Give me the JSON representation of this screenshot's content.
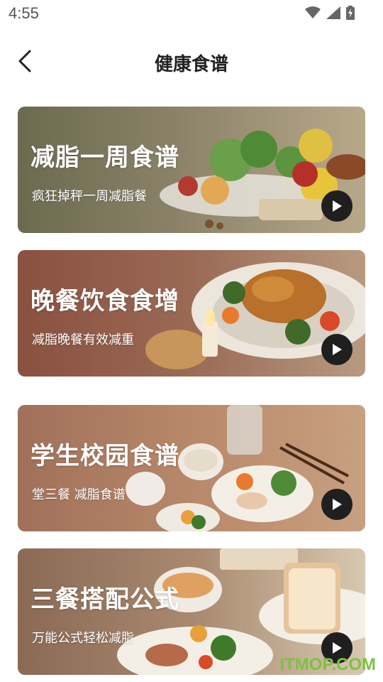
{
  "status_bar": {
    "time": "4:55",
    "icons": [
      "wifi-icon",
      "signal-icon",
      "battery-charging-icon"
    ]
  },
  "header": {
    "title": "健康食谱",
    "back_icon": "chevron-left-icon"
  },
  "cards": [
    {
      "title": "减脂一周食谱",
      "subtitle": "疯狂掉秤一周减脂餐",
      "play_icon": "play-icon"
    },
    {
      "title": "晚餐饮食食增",
      "subtitle": "减脂晚餐有效减重",
      "play_icon": "play-icon"
    },
    {
      "title": "学生校园食谱",
      "subtitle": "堂三餐 减脂食谱",
      "play_icon": "play-icon"
    },
    {
      "title": "三餐搭配公式",
      "subtitle": "万能公式轻松减脂",
      "play_icon": "play-icon"
    }
  ],
  "watermark": {
    "text": "ITMOP.COM"
  },
  "colors": {
    "play_button": "#1f1f1f",
    "watermark": "#7cc242",
    "title": "#222222"
  }
}
